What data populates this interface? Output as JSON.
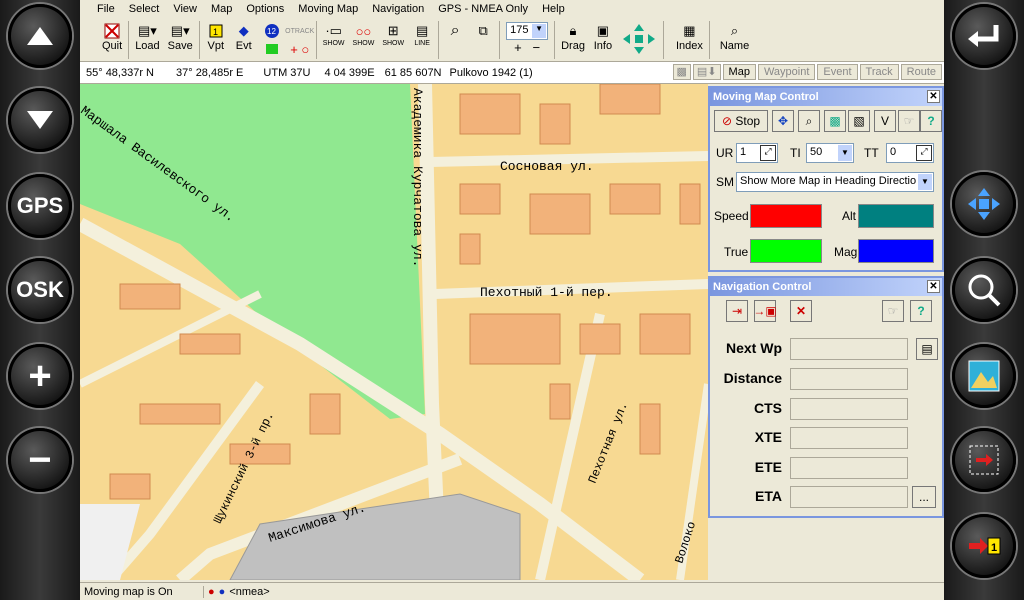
{
  "menu": [
    "File",
    "Select",
    "View",
    "Map",
    "Options",
    "Moving Map",
    "Navigation",
    "GPS - NMEA Only",
    "Help"
  ],
  "toolbar": {
    "quit": "Quit",
    "load": "Load",
    "save": "Save",
    "vpt": "Vpt",
    "evt": "Evt",
    "show1": "SHOW",
    "show2": "SHOW",
    "show3": "SHOW",
    "line": "LINE",
    "zoom_value": "175",
    "drag": "Drag",
    "info": "Info",
    "index": "Index",
    "name": "Name"
  },
  "status": {
    "lat": "55° 48,337r N",
    "lon": "37° 28,485r E",
    "utm": "UTM 37U",
    "east": "4 04 399E",
    "north": "61 85 607N",
    "datum": "Pulkovo 1942 (1)"
  },
  "tabs": [
    "Map",
    "Waypoint",
    "Event",
    "Track",
    "Route"
  ],
  "map_labels": {
    "street1": "Сосновая ул.",
    "street2": "Пехотный 1-й пер.",
    "street3": "Маршала Василевского ул.",
    "street4": "Академика Курчатова ул.",
    "street5": "Щукинский 3-й пр.",
    "street6": "Максимова ул.",
    "street7": "Пехотная ул.",
    "street8": "Волоко"
  },
  "moving_map": {
    "title": "Moving Map Control",
    "stop": "Stop",
    "v": "V",
    "ur_label": "UR",
    "ur_value": "1",
    "ti_label": "TI",
    "ti_value": "50",
    "tt_label": "TT",
    "tt_value": "0",
    "sm_label": "SM",
    "sm_value": "Show More Map in Heading Directio",
    "speed": "Speed",
    "alt": "Alt",
    "true": "True",
    "mag": "Mag",
    "colors": {
      "speed": "#ff0000",
      "alt": "#008080",
      "true": "#00ff00",
      "mag": "#0000ff"
    }
  },
  "navigation": {
    "title": "Navigation Control",
    "fields": [
      "Next Wp",
      "Distance",
      "CTS",
      "XTE",
      "ETE",
      "ETA"
    ],
    "eta_button": "..."
  },
  "bottom": {
    "status": "Moving map is On",
    "nmea": "<nmea>"
  },
  "left_buttons": [
    "up-arrow",
    "down-arrow",
    "GPS",
    "OSK",
    "+",
    "−"
  ],
  "right_buttons": [
    "enter-icon",
    "move-icon",
    "zoom-icon",
    "map-icon",
    "route-icon",
    "waypoint-icon"
  ]
}
